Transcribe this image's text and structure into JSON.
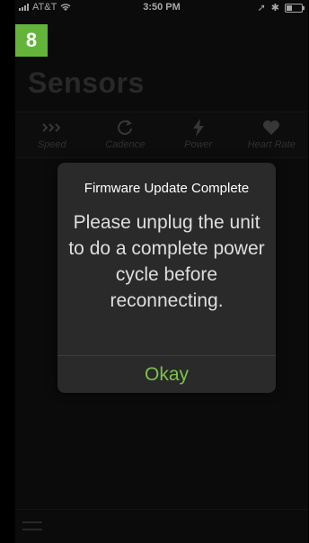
{
  "status": {
    "carrier": "AT&T",
    "time": "3:50 PM"
  },
  "step_badge": "8",
  "page": {
    "title": "Sensors"
  },
  "tabs": [
    {
      "label": "Speed",
      "icon": "speed-chevrons-icon"
    },
    {
      "label": "Cadence",
      "icon": "cadence-refresh-icon"
    },
    {
      "label": "Power",
      "icon": "power-bolt-icon"
    },
    {
      "label": "Heart Rate",
      "icon": "heart-icon"
    }
  ],
  "dialog": {
    "title": "Firmware Update Complete",
    "message": "Please unplug the unit to do a complete power cycle before reconnecting.",
    "button": "Okay"
  },
  "colors": {
    "accent": "#7cc24a",
    "badge": "#64b43c",
    "background": "#121212",
    "dialog_bg": "#2a2a2a"
  }
}
